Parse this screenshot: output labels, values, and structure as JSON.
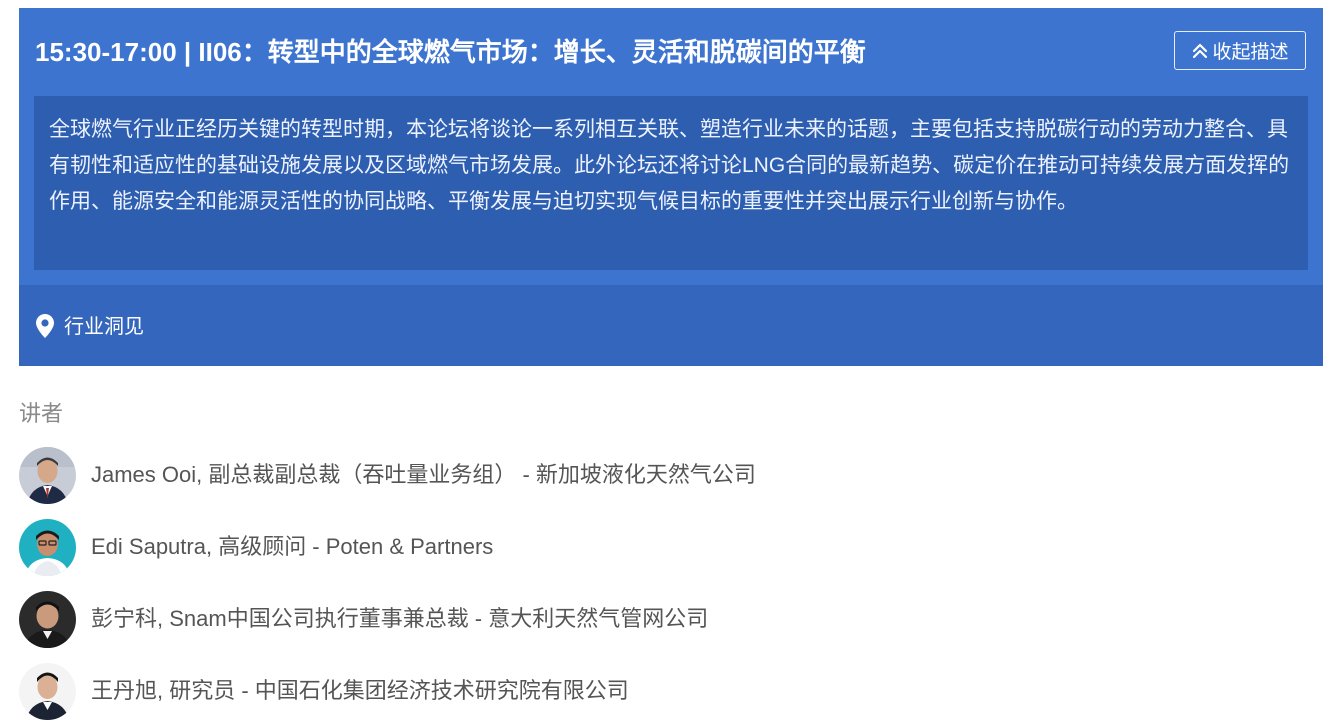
{
  "session": {
    "title": "15:30-17:00 | II06：转型中的全球燃气市场：增长、灵活和脱碳间的平衡",
    "collapse_label": "收起描述",
    "collapse_icon": "chevron-double-up-icon",
    "description": "全球燃气行业正经历关键的转型时期，本论坛将谈论一系列相互关联、塑造行业未来的话题，主要包括支持脱碳行动的劳动力整合、具有韧性和适应性的基础设施发展以及区域燃气市场发展。此外论坛还将讨论LNG合同的最新趋势、碳定价在推动可持续发展方面发挥的作用、能源安全和能源灵活性的协同战略、平衡发展与迫切实现气候目标的重要性并突出展示行业创新与协作。",
    "location_icon": "map-marker-icon",
    "location": "行业洞见"
  },
  "speakers": {
    "heading": "讲者",
    "items": [
      {
        "text": "James Ooi, 副总裁副总裁（吞吐量业务组） - 新加坡液化天然气公司"
      },
      {
        "text": "Edi Saputra, 高级顾问 - Poten & Partners"
      },
      {
        "text": "彭宁科, Snam中国公司执行董事兼总裁 - 意大利天然气管网公司"
      },
      {
        "text": "王丹旭, 研究员 - 中国石化集团经济技术研究院有限公司"
      }
    ]
  },
  "colors": {
    "header_blue": "#3d74d0",
    "description_blue": "#2e5eaf",
    "location_blue": "#3466bd",
    "speaker_text": "#555555",
    "heading_gray": "#8a8a8a"
  }
}
